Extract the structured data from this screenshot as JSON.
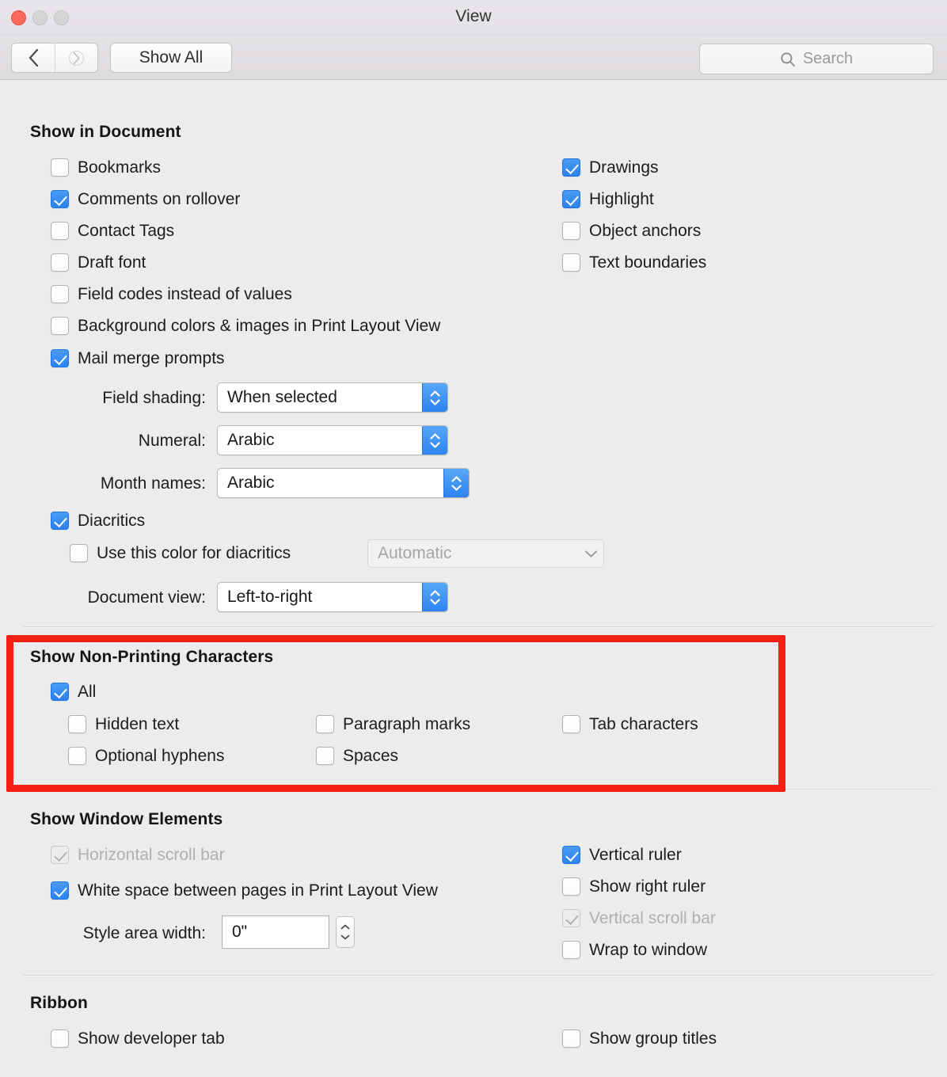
{
  "window": {
    "title": "View",
    "traffic_lights": [
      "close-button",
      "minimize-button",
      "maximize-button"
    ]
  },
  "toolbar": {
    "back_icon": "chevron-left-icon",
    "forward_icon": "chevron-right-icon",
    "show_all_label": "Show All",
    "search_icon": "search-icon",
    "search_placeholder": "Search",
    "search_value": ""
  },
  "colors": {
    "accent_blue": "#2d84f0",
    "highlight_red": "#f52013",
    "window_bg": "#ececec",
    "text": "#1c1c1c",
    "text_disabled": "#b0b0b0"
  },
  "sections": {
    "show_in_document": {
      "title": "Show in Document",
      "left_items": [
        {
          "label": "Bookmarks",
          "checked": false,
          "enabled": true
        },
        {
          "label": "Comments on rollover",
          "checked": true,
          "enabled": true
        },
        {
          "label": "Contact Tags",
          "checked": false,
          "enabled": true
        },
        {
          "label": "Draft font",
          "checked": false,
          "enabled": true
        },
        {
          "label": "Field codes instead of values",
          "checked": false,
          "enabled": true
        },
        {
          "label": "Background colors & images in Print Layout View",
          "checked": false,
          "enabled": true
        },
        {
          "label": "Mail merge prompts",
          "checked": true,
          "enabled": true
        }
      ],
      "right_items": [
        {
          "label": "Drawings",
          "checked": true,
          "enabled": true
        },
        {
          "label": "Highlight",
          "checked": true,
          "enabled": true
        },
        {
          "label": "Object anchors",
          "checked": false,
          "enabled": true
        },
        {
          "label": "Text boundaries",
          "checked": false,
          "enabled": true
        }
      ],
      "field_shading": {
        "label": "Field shading:",
        "value": "When selected"
      },
      "numeral": {
        "label": "Numeral:",
        "value": "Arabic"
      },
      "month_names": {
        "label": "Month names:",
        "value": "Arabic"
      },
      "diacritics": {
        "label": "Diacritics",
        "checked": true
      },
      "use_color_for_diacritics": {
        "label": "Use this color for diacritics",
        "checked": false
      },
      "diacritics_color": {
        "value": "Automatic",
        "enabled": false
      },
      "document_view": {
        "label": "Document view:",
        "value": "Left-to-right"
      }
    },
    "show_non_printing": {
      "title": "Show Non-Printing Characters",
      "highlighted": true,
      "all": {
        "label": "All",
        "checked": true
      },
      "items": [
        {
          "label": "Hidden text",
          "checked": false
        },
        {
          "label": "Paragraph marks",
          "checked": false
        },
        {
          "label": "Tab characters",
          "checked": false
        },
        {
          "label": "Optional hyphens",
          "checked": false
        },
        {
          "label": "Spaces",
          "checked": false
        }
      ]
    },
    "show_window_elements": {
      "title": "Show Window Elements",
      "left_items": [
        {
          "label": "Horizontal scroll bar",
          "checked": true,
          "enabled": false
        },
        {
          "label": "White space between pages in Print Layout View",
          "checked": true,
          "enabled": true
        }
      ],
      "right_items": [
        {
          "label": "Vertical ruler",
          "checked": true,
          "enabled": true
        },
        {
          "label": "Show right ruler",
          "checked": false,
          "enabled": true
        },
        {
          "label": "Vertical scroll bar",
          "checked": true,
          "enabled": false
        },
        {
          "label": "Wrap to window",
          "checked": false,
          "enabled": true
        }
      ],
      "style_area_width": {
        "label": "Style area width:",
        "value": "0\""
      }
    },
    "ribbon": {
      "title": "Ribbon",
      "left_items": [
        {
          "label": "Show developer tab",
          "checked": false,
          "enabled": true
        }
      ],
      "right_items": [
        {
          "label": "Show group titles",
          "checked": false,
          "enabled": true
        }
      ]
    }
  }
}
